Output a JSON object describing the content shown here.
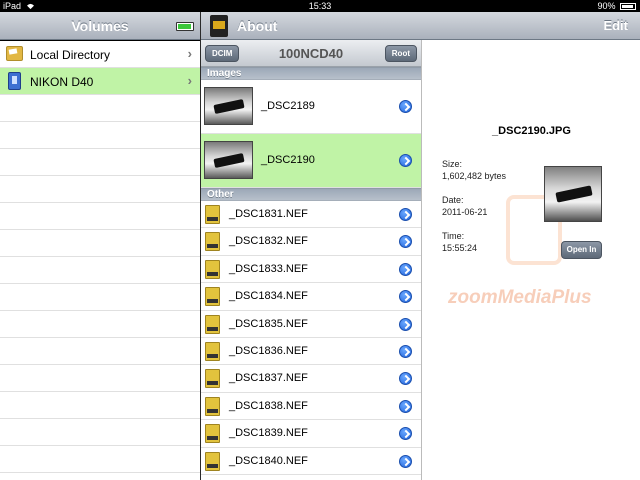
{
  "status_bar": {
    "device": "iPad",
    "time": "15:33",
    "battery": "90%"
  },
  "volumes_nav": {
    "title": "Volumes"
  },
  "volumes": [
    {
      "label": "Local Directory",
      "icon": "folder-icon",
      "selected": false
    },
    {
      "label": "NIKON D40",
      "icon": "memory-card-icon",
      "selected": true
    }
  ],
  "about_nav": {
    "title": "About",
    "edit_label": "Edit"
  },
  "browser": {
    "title": "100NCD40",
    "dcim_button": "DCIM",
    "root_button": "Root",
    "images_header": "Images",
    "images": [
      {
        "name": "_DSC2189",
        "selected": false
      },
      {
        "name": "_DSC2190",
        "selected": true
      }
    ],
    "other_header": "Other",
    "files": [
      "_DSC1831.NEF",
      "_DSC1832.NEF",
      "_DSC1833.NEF",
      "_DSC1834.NEF",
      "_DSC1835.NEF",
      "_DSC1836.NEF",
      "_DSC1837.NEF",
      "_DSC1838.NEF",
      "_DSC1839.NEF",
      "_DSC1840.NEF"
    ]
  },
  "detail": {
    "filename": "_DSC2190.JPG",
    "size_label": "Size:",
    "size_value": "1,602,482 bytes",
    "date_label": "Date:",
    "date_value": "2011-06-21",
    "time_label": "Time:",
    "time_value": "15:55:24",
    "open_button": "Open In",
    "watermark": "zoomMediaPlus"
  },
  "colors": {
    "selection": "#c0f3a6",
    "disclosure": "#1f62d9",
    "navbar": "#aab1bc"
  }
}
